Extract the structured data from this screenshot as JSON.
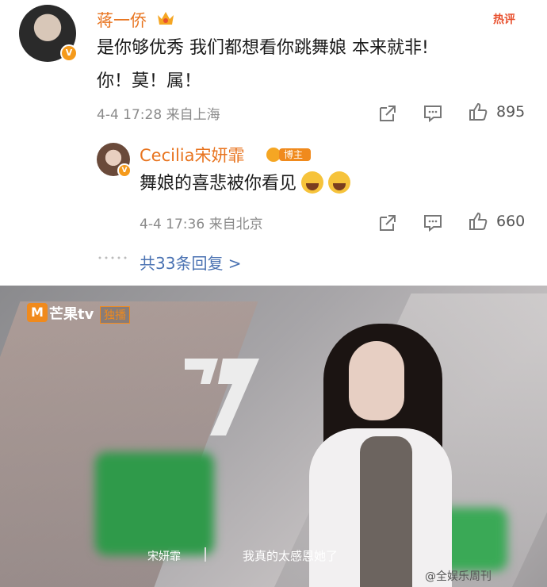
{
  "main_comment": {
    "username": "蒋一侨",
    "hot_label": "热评",
    "line1": "是你够优秀 我们都想看你跳舞娘 本来就非!",
    "line2": "你！莫！属！",
    "meta": "4-4 17:28  来自上海",
    "like_count": "895"
  },
  "reply": {
    "username": "Cecilia宋妍霏",
    "badge": "博主",
    "text": "舞娘的喜悲被你看见",
    "meta": "4-4 17:36  来自北京",
    "like_count": "660"
  },
  "more_replies": "共33条回复 >",
  "video": {
    "channel": "芒果tv",
    "channel_tag": "独播",
    "speaker": "宋妍霏",
    "subtitle": "我真的太感恩她了",
    "watermark": "@全娱乐周刊"
  }
}
